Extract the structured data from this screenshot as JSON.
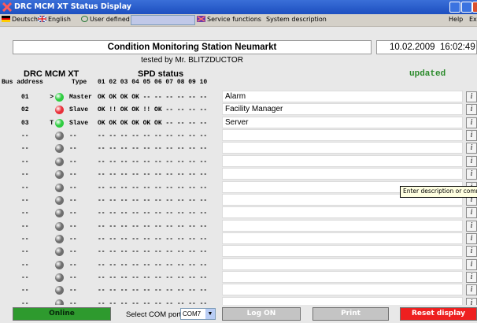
{
  "window": {
    "title": "DRC MCM XT Status Display"
  },
  "menu": {
    "deutsch": "Deutsch",
    "english": "English",
    "user_defined": "User defined",
    "service": "Service functions",
    "system": "System description",
    "help": "Help",
    "exit": "Ex"
  },
  "header": {
    "station": "Condition Monitoring Station Neumarkt",
    "date": "10.02.2009",
    "time": "16:02:49",
    "tested_by": "tested by Mr. BLITZDUCTOR",
    "device_title": "DRC MCM XT",
    "spd_title": "SPD status",
    "status": "updated"
  },
  "columns": {
    "bus": "Bus address",
    "type": "Type",
    "spd_numbers": "01 02 03 04 05 06 07 08 09 10"
  },
  "rows": [
    {
      "bus": "01",
      "mark": ">",
      "led": "green",
      "type": "Master",
      "spd": "OK OK OK OK -- -- -- -- -- --",
      "desc": "Alarm"
    },
    {
      "bus": "02",
      "mark": "",
      "led": "red",
      "type": "Slave",
      "spd": "OK !! OK OK !! OK -- -- -- --",
      "desc": "Facility Manager"
    },
    {
      "bus": "03",
      "mark": "T",
      "led": "green",
      "type": "Slave",
      "spd": "OK OK OK OK OK OK -- -- -- --",
      "desc": "Server"
    },
    {
      "bus": "--",
      "mark": "",
      "led": "gray",
      "type": "--",
      "spd": "-- -- -- -- -- -- -- -- -- --",
      "desc": ""
    },
    {
      "bus": "--",
      "mark": "",
      "led": "gray",
      "type": "--",
      "spd": "-- -- -- -- -- -- -- -- -- --",
      "desc": ""
    },
    {
      "bus": "--",
      "mark": "",
      "led": "gray",
      "type": "--",
      "spd": "-- -- -- -- -- -- -- -- -- --",
      "desc": ""
    },
    {
      "bus": "--",
      "mark": "",
      "led": "gray",
      "type": "--",
      "spd": "-- -- -- -- -- -- -- -- -- --",
      "desc": ""
    },
    {
      "bus": "--",
      "mark": "",
      "led": "gray",
      "type": "--",
      "spd": "-- -- -- -- -- -- -- -- -- --",
      "desc": ""
    },
    {
      "bus": "--",
      "mark": "",
      "led": "gray",
      "type": "--",
      "spd": "-- -- -- -- -- -- -- -- -- --",
      "desc": ""
    },
    {
      "bus": "--",
      "mark": "",
      "led": "gray",
      "type": "--",
      "spd": "-- -- -- -- -- -- -- -- -- --",
      "desc": ""
    },
    {
      "bus": "--",
      "mark": "",
      "led": "gray",
      "type": "--",
      "spd": "-- -- -- -- -- -- -- -- -- --",
      "desc": ""
    },
    {
      "bus": "--",
      "mark": "",
      "led": "gray",
      "type": "--",
      "spd": "-- -- -- -- -- -- -- -- -- --",
      "desc": ""
    },
    {
      "bus": "--",
      "mark": "",
      "led": "gray",
      "type": "--",
      "spd": "-- -- -- -- -- -- -- -- -- --",
      "desc": ""
    },
    {
      "bus": "--",
      "mark": "",
      "led": "gray",
      "type": "--",
      "spd": "-- -- -- -- -- -- -- -- -- --",
      "desc": ""
    },
    {
      "bus": "--",
      "mark": "",
      "led": "gray",
      "type": "--",
      "spd": "-- -- -- -- -- -- -- -- -- --",
      "desc": ""
    },
    {
      "bus": "--",
      "mark": "",
      "led": "gray",
      "type": "--",
      "spd": "-- -- -- -- -- -- -- -- -- --",
      "desc": ""
    },
    {
      "bus": "--",
      "mark": "",
      "led": "gray",
      "type": "--",
      "spd": "-- -- -- -- -- -- -- -- -- --",
      "desc": ""
    }
  ],
  "info_icon_glyph": "i",
  "tooltip": "Enter description or comment",
  "footer": {
    "online": "Online",
    "com_label": "Select COM port",
    "com_value": "COM7",
    "logon": "Log ON",
    "print": "Print",
    "reset": "Reset display"
  },
  "colors": {
    "led_green": "#2ecc40",
    "led_red": "#e8303a",
    "led_gray": "#6e6e6e",
    "online_green": "#2e9a2e",
    "reset_red": "#ee2020",
    "title_blue": "#1d4fc0"
  }
}
